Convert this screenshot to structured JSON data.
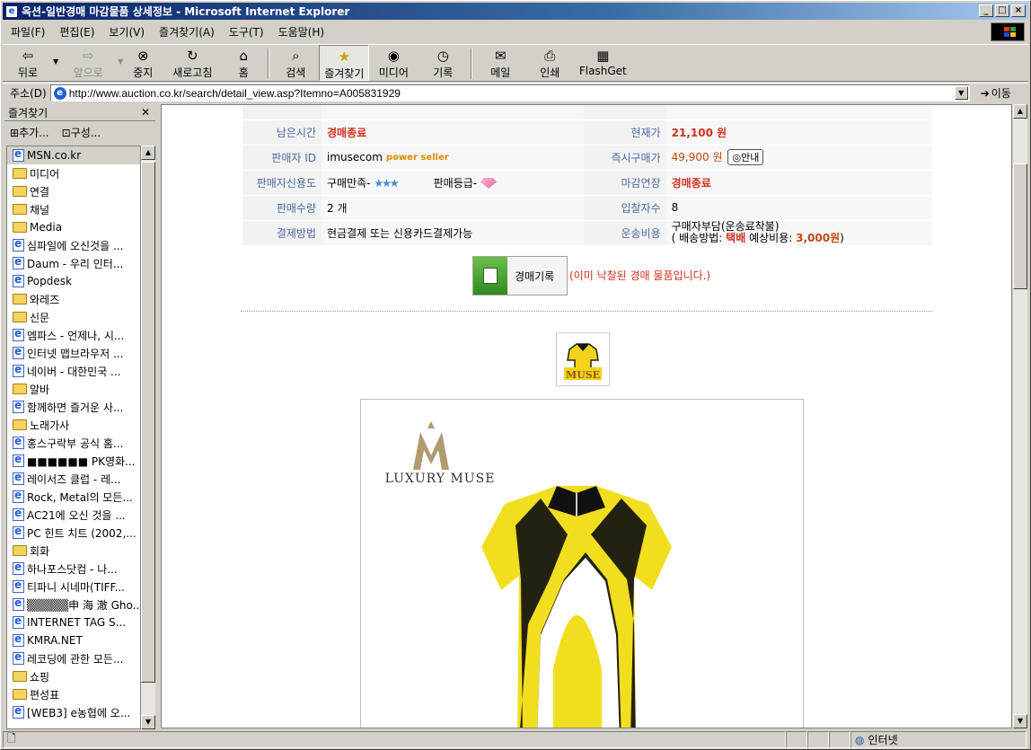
{
  "window": {
    "title": "옥션-일반경매 마감물품 상세정보 - Microsoft Internet Explorer"
  },
  "menu": [
    "파일(F)",
    "편집(E)",
    "보기(V)",
    "즐겨찾기(A)",
    "도구(T)",
    "도움말(H)"
  ],
  "toolbar": {
    "back": "뒤로",
    "forward": "앞으로",
    "stop": "중지",
    "refresh": "새로고침",
    "home": "홈",
    "search": "검색",
    "favorites": "즐겨찾기",
    "media": "미디어",
    "history": "기록",
    "mail": "메일",
    "print": "인쇄",
    "flashget": "FlashGet"
  },
  "address": {
    "label": "주소(D)",
    "url": "http://www.auction.co.kr/search/detail_view.asp?Itemno=A005831929",
    "go": "이동"
  },
  "sidebar": {
    "title": "즐겨찾기",
    "add": "추가...",
    "organize": "구성...",
    "items": [
      {
        "label": "MSN.co.kr",
        "type": "page"
      },
      {
        "label": "미디어",
        "type": "folder"
      },
      {
        "label": "연결",
        "type": "folder"
      },
      {
        "label": "채널",
        "type": "folder"
      },
      {
        "label": "Media",
        "type": "folder"
      },
      {
        "label": "심파일에 오신것을 ...",
        "type": "page"
      },
      {
        "label": "Daum - 우리 인터...",
        "type": "page"
      },
      {
        "label": "Popdesk",
        "type": "page"
      },
      {
        "label": "와레즈",
        "type": "folder"
      },
      {
        "label": "신문",
        "type": "folder"
      },
      {
        "label": "엠파스 - 언제나, 시...",
        "type": "page"
      },
      {
        "label": "인터넷 맵브라우저 ...",
        "type": "page"
      },
      {
        "label": "네이버 - 대한민국 ...",
        "type": "page"
      },
      {
        "label": "알바",
        "type": "folder"
      },
      {
        "label": "함께하면 즐거운 사...",
        "type": "page"
      },
      {
        "label": "노래가사",
        "type": "folder"
      },
      {
        "label": "홍스구락부 공식 홈...",
        "type": "page"
      },
      {
        "label": "■■■■■■ PK영화...",
        "type": "page"
      },
      {
        "label": "레이서즈 클럽 - 레...",
        "type": "page"
      },
      {
        "label": "Rock, Metal의 모든...",
        "type": "page"
      },
      {
        "label": "AC21에 오신 것을 ...",
        "type": "page"
      },
      {
        "label": "PC 힌트 치트 (2002,...",
        "type": "page"
      },
      {
        "label": "회화",
        "type": "folder"
      },
      {
        "label": "하나포스닷컴 - 나...",
        "type": "page"
      },
      {
        "label": "티파니 시네마(TIFF...",
        "type": "page"
      },
      {
        "label": "▒▒▒▒▒申 海 澈 Gho...",
        "type": "page"
      },
      {
        "label": "INTERNET TAG S...",
        "type": "page"
      },
      {
        "label": "KMRA.NET",
        "type": "page"
      },
      {
        "label": "레코딩에 관한 모든...",
        "type": "page"
      },
      {
        "label": "쇼핑",
        "type": "folder"
      },
      {
        "label": "편성표",
        "type": "folder"
      },
      {
        "label": "[WEB3] e농협에 오...",
        "type": "page"
      }
    ]
  },
  "auction": {
    "remaining_label": "남은시간",
    "remaining": "경매종료",
    "current_label": "현재가",
    "current": "21,100 원",
    "seller_label": "판매자 ID",
    "seller": "imusecom",
    "power_seller": "power seller",
    "buynow_label": "즉시구매가",
    "buynow": "49,900 원",
    "guide": "안내",
    "credit_label": "판매자신용도",
    "credit": "구매만족-",
    "stars": "★★★",
    "grade": "판매등급-",
    "deadline_label": "마감연장",
    "deadline": "경매종료",
    "qty_label": "판매수량",
    "qty": "2 개",
    "bidders_label": "입찰자수",
    "bidders": "8",
    "pay_label": "결제방법",
    "pay": "현금결제 또는 신용카드결제가능",
    "ship_label": "운송비용",
    "ship1": "구매자부담(운송료착불)",
    "ship2a": "( 배송방법:",
    "ship2b": "택배",
    "ship2c": "예상비용:",
    "ship2d": "3,000원",
    "ship2e": ")",
    "record_btn": "경매기록",
    "closed_msg": "(이미 낙찰된 경매 물품입니다.)",
    "brand": "LUXURY MUSE",
    "thumb_brand": "MUSE"
  },
  "status": {
    "zone": "인터넷"
  }
}
